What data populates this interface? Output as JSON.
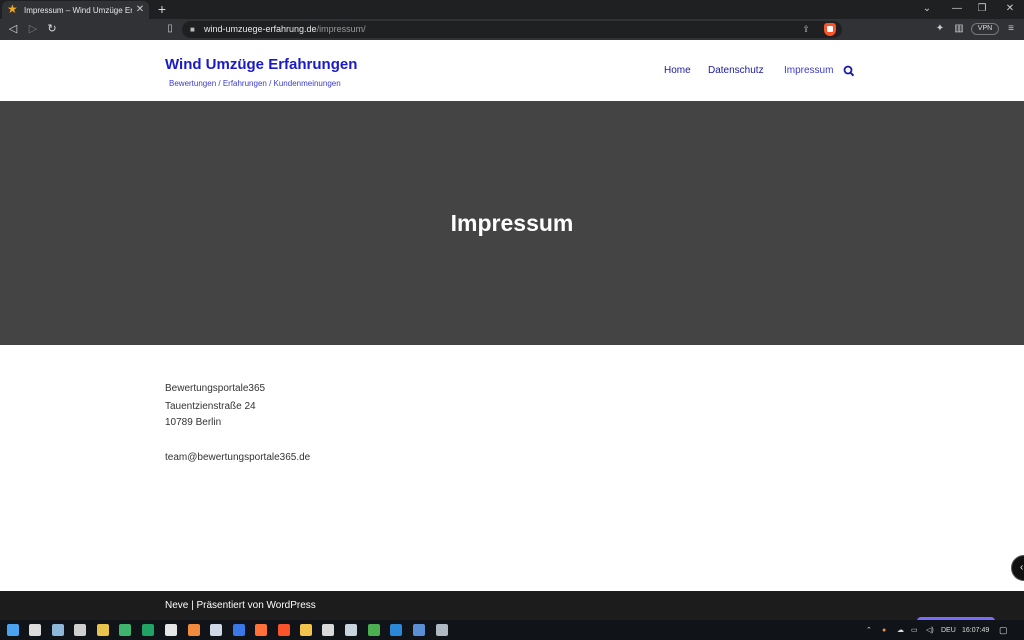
{
  "browser": {
    "tab_title": "Impressum – Wind Umzüge Erfahrungen",
    "url_host": "wind-umzuege-erfahrung.de",
    "url_path": "/impressum/",
    "vpn_label": "VPN",
    "new_tab_glyph": "+",
    "close_tab_glyph": "✕"
  },
  "site": {
    "title": "Wind Umzüge Erfahrungen",
    "tagline": "Bewertungen / Erfahrungen / Kundenmeinungen",
    "menu": [
      "Home",
      "Datenschutz",
      "Impressum"
    ],
    "active_menu": "Impressum"
  },
  "hero": {
    "title": "Impressum"
  },
  "content": {
    "company": "Bewertungsportale365",
    "street": "Tauentzienstraße 24",
    "city": "10789 Berlin",
    "email": "team@bewertungsportale365.de"
  },
  "footer": {
    "text": "Neve | Präsentiert von WordPress"
  },
  "taskbar": {
    "language": "DEU",
    "time": "16:07:49"
  },
  "colors": {
    "link_blue": "#1a1ac8",
    "hero_bg": "#444444",
    "footer_bg": "#1c1c1c",
    "brave_orange": "#fb542b"
  }
}
